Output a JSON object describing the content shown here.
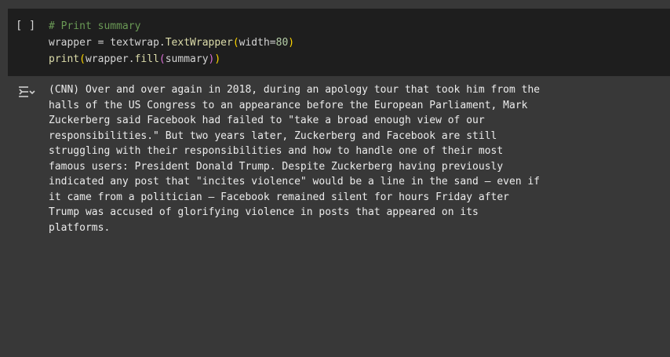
{
  "cell": {
    "run_indicator": "[ ]",
    "code": {
      "comment": "# Print summary",
      "line2": {
        "target": "wrapper",
        "assign": " = ",
        "module": "textwrap.",
        "class_name": "TextWrapper",
        "open": "(",
        "arg_name": "width",
        "eq": "=",
        "arg_value": "80",
        "close": ")"
      },
      "line3": {
        "func": "print",
        "open1": "(",
        "obj": "wrapper.",
        "method": "fill",
        "open2": "(",
        "arg": "summary",
        "close2": ")",
        "close1": ")"
      }
    }
  },
  "output": {
    "toggle_icon": "output-toggle-icon",
    "lines": [
      "(CNN) Over and over again in 2018, during an apology tour that took him from the",
      "halls of the US Congress to an appearance before the European Parliament, Mark",
      "Zuckerberg said Facebook had failed to \"take a broad enough view of our",
      "responsibilities.\" But two years later, Zuckerberg and Facebook are still",
      "struggling with their responsibilities and how to handle one of their most",
      "famous users: President Donald Trump. Despite Zuckerberg having previously",
      "indicated any post that \"incites violence\" would be a line in the sand — even if",
      "it came from a politician — Facebook remained silent for hours Friday after",
      "Trump was accused of glorifying violence in posts that appeared on its",
      "platforms."
    ]
  },
  "colors": {
    "cell_background": "#1e1e1e",
    "page_background": "#383838",
    "comment": "#6a9955",
    "function": "#dcdcaa",
    "number": "#b5cea8",
    "bracket_level1": "#ffd700",
    "bracket_level2": "#da70d6"
  }
}
